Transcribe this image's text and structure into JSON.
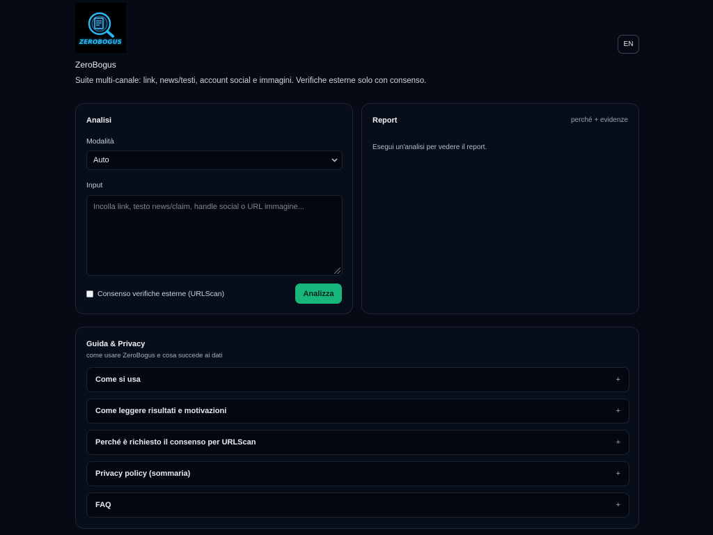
{
  "header": {
    "logo_text": "ZEROBOGUS",
    "app_name": "ZeroBogus",
    "tagline": "Suite multi-canale: link, news/testi, account social e immagini. Verifiche esterne solo con consenso.",
    "lang_button": "EN"
  },
  "analisi": {
    "title": "Analisi",
    "mode_label": "Modalità",
    "mode_value": "Auto",
    "input_label": "Input",
    "input_value": "",
    "input_placeholder": "Incolla link, testo news/claim, handle social o URL immagine...",
    "consent_label": "Consenso verifiche esterne (URLScan)",
    "consent_checked": false,
    "analyze_button": "Analizza"
  },
  "report": {
    "title": "Report",
    "hint": "perché + evidenze",
    "empty_text": "Esegui un'analisi per vedere il report."
  },
  "guide": {
    "title": "Guida & Privacy",
    "subtitle": "come usare ZeroBogus e cosa succede ai dati",
    "items": [
      {
        "label": "Come si usa",
        "icon": "+"
      },
      {
        "label": "Come leggere risultati e motivazioni",
        "icon": "+"
      },
      {
        "label": "Perché è richiesto il consenso per URLScan",
        "icon": "+"
      },
      {
        "label": "Privacy policy (sommaria)",
        "icon": "+"
      },
      {
        "label": "FAQ",
        "icon": "+"
      }
    ]
  },
  "colors": {
    "background": "#050a14",
    "card": "#070d19",
    "accent": "#18b57c",
    "logo": "#29b6f6"
  }
}
